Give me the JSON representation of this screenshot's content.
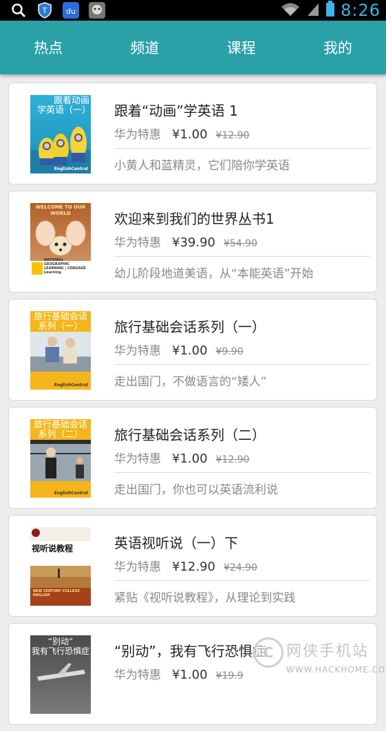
{
  "status_bar": {
    "time": "8:26",
    "icons": [
      "search-icon",
      "shield-icon",
      "baidu-icon",
      "robot-icon",
      "wifi-icon",
      "signal-icon",
      "battery-icon"
    ]
  },
  "nav": {
    "tabs": [
      "热点",
      "频道",
      "课程",
      "我的"
    ]
  },
  "courses": [
    {
      "title": "跟着“动画”学英语 1",
      "vendor": "华为特惠",
      "price": "¥1.00",
      "original_price": "¥12.90",
      "description": "小黄人和蓝精灵，它们陪你学英语",
      "cover_text": "跟着动画\n学英语（一）",
      "cover_brand": "EnglishCentral"
    },
    {
      "title": "欢迎来到我们的世界丛书1",
      "vendor": "华为特惠",
      "price": "¥39.90",
      "original_price": "¥54.90",
      "description": "幼儿阶段地道美语，从“本能英语”开始",
      "cover_text": "WELCOME TO OUR WORLD",
      "cover_brand": "NATIONAL GEOGRAPHIC LEARNING | CENGAGE Learning"
    },
    {
      "title": "旅行基础会话系列（一）",
      "vendor": "华为特惠",
      "price": "¥1.00",
      "original_price": "¥9.90",
      "description": "走出国门，不做语言的“矮人”",
      "cover_text": "旅行基础会话\n系列（一）",
      "cover_brand": "EnglishCentral"
    },
    {
      "title": "旅行基础会话系列（二）",
      "vendor": "华为特惠",
      "price": "¥1.00",
      "original_price": "¥12.90",
      "description": "走出国门，你也可以英语流利说",
      "cover_text": "旅行基础会话\n系列（二）",
      "cover_brand": "EnglishCentral"
    },
    {
      "title": "英语视听说（一）下",
      "vendor": "华为特惠",
      "price": "¥12.90",
      "original_price": "¥24.90",
      "description": "紧贴《视听说教程》，从理论到实践",
      "cover_text": "视听说教程",
      "cover_brand": "NEW CENTURY COLLEGE ENGLISH"
    },
    {
      "title": "“别动”，我有飞行恐惧症",
      "vendor": "华为特惠",
      "price": "¥1.00",
      "original_price": "¥19.9",
      "description": "",
      "cover_text": "“别动”\n我有飞行恐惧症",
      "cover_brand": ""
    }
  ],
  "watermark": {
    "cn": "网侠手机站",
    "en": "WWW.HACKHOME.COM"
  },
  "colors": {
    "nav_bg": "#2aa0a7",
    "time": "#3db3e6",
    "page_bg": "#ededed"
  }
}
